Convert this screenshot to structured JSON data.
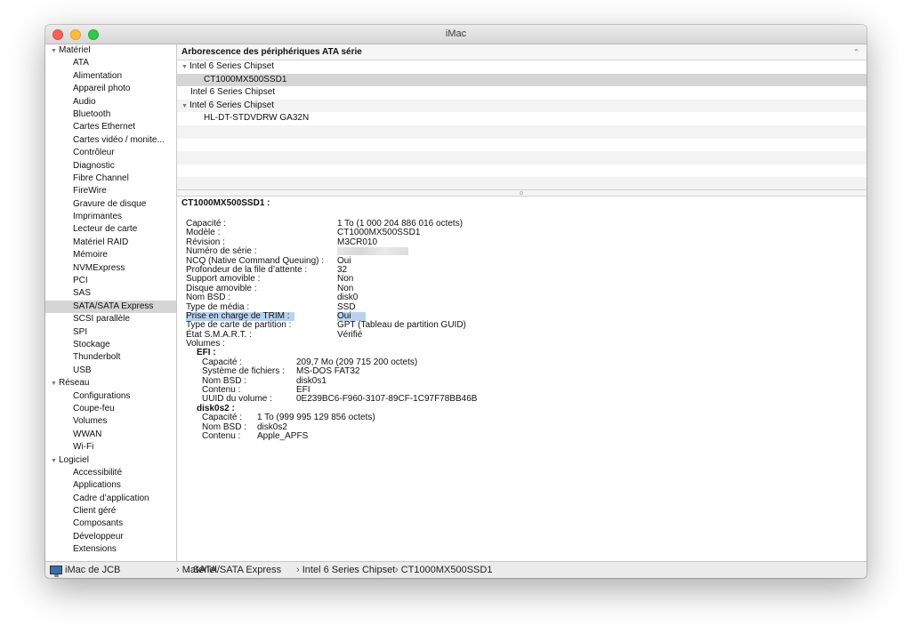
{
  "window": {
    "title": "iMac"
  },
  "sidebar": {
    "items": [
      {
        "label": "Matériel",
        "group": true
      },
      {
        "label": "ATA"
      },
      {
        "label": "Alimentation"
      },
      {
        "label": "Appareil photo"
      },
      {
        "label": "Audio"
      },
      {
        "label": "Bluetooth"
      },
      {
        "label": "Cartes Ethernet"
      },
      {
        "label": "Cartes vidéo / monite..."
      },
      {
        "label": "Contrôleur"
      },
      {
        "label": "Diagnostic"
      },
      {
        "label": "Fibre Channel"
      },
      {
        "label": "FireWire"
      },
      {
        "label": "Gravure de disque"
      },
      {
        "label": "Imprimantes"
      },
      {
        "label": "Lecteur de carte"
      },
      {
        "label": "Matériel RAID"
      },
      {
        "label": "Mémoire"
      },
      {
        "label": "NVMExpress"
      },
      {
        "label": "PCI"
      },
      {
        "label": "SAS"
      },
      {
        "label": "SATA/SATA Express",
        "selected": true
      },
      {
        "label": "SCSI parallèle"
      },
      {
        "label": "SPI"
      },
      {
        "label": "Stockage"
      },
      {
        "label": "Thunderbolt"
      },
      {
        "label": "USB"
      },
      {
        "label": "Réseau",
        "group": true
      },
      {
        "label": "Configurations"
      },
      {
        "label": "Coupe-feu"
      },
      {
        "label": "Volumes"
      },
      {
        "label": "WWAN"
      },
      {
        "label": "Wi-Fi"
      },
      {
        "label": "Logiciel",
        "group": true
      },
      {
        "label": "Accessibilité"
      },
      {
        "label": "Applications"
      },
      {
        "label": "Cadre d’application"
      },
      {
        "label": "Client géré"
      },
      {
        "label": "Composants"
      },
      {
        "label": "Développeur"
      },
      {
        "label": "Extensions"
      }
    ]
  },
  "tree": {
    "header": "Arborescence des périphériques ATA série",
    "rows": [
      {
        "label": "Intel 6 Series Chipset",
        "level": 0,
        "expanded": true
      },
      {
        "label": "CT1000MX500SSD1",
        "level": 1,
        "selected": true
      },
      {
        "label": "Intel 6 Series Chipset",
        "level": 0
      },
      {
        "label": "Intel 6 Series Chipset",
        "level": 0,
        "expanded": true
      },
      {
        "label": "HL-DT-STDVDRW  GA32N",
        "level": 1
      }
    ]
  },
  "detail": {
    "title": "CT1000MX500SSD1 :",
    "properties": [
      {
        "key": "Capacité :",
        "value": "1 To (1 000 204 886 016 octets)"
      },
      {
        "key": "Modèle :",
        "value": "CT1000MX500SSD1"
      },
      {
        "key": "Révision :",
        "value": "M3CR010"
      },
      {
        "key": "Numéro de série :",
        "value": "",
        "redacted": true
      },
      {
        "key": "NCQ (Native Command Queuing) :",
        "value": "Oui"
      },
      {
        "key": "Profondeur de la file d’attente :",
        "value": "32"
      },
      {
        "key": "Support amovible :",
        "value": "Non"
      },
      {
        "key": "Disque amovible :",
        "value": "Non"
      },
      {
        "key": "Nom BSD :",
        "value": "disk0"
      },
      {
        "key": "Type de média :",
        "value": "SSD"
      },
      {
        "key": "Prise en charge de TRIM :",
        "value": "Oui",
        "highlight": true
      },
      {
        "key": "Type de carte de partition :",
        "value": "GPT (Tableau de partition GUID)"
      },
      {
        "key": "État S.M.A.R.T. :",
        "value": "Vérifié"
      },
      {
        "key": "Volumes :",
        "value": ""
      }
    ],
    "volumes": [
      {
        "name": "EFI :",
        "props": [
          {
            "key": "Capacité :",
            "value": "209,7 Mo (209 715 200 octets)"
          },
          {
            "key": "Système de fichiers :",
            "value": "MS-DOS FAT32"
          },
          {
            "key": "Nom BSD :",
            "value": "disk0s1"
          },
          {
            "key": "Contenu :",
            "value": "EFI"
          },
          {
            "key": "UUID du volume :",
            "value": "0E239BC6-F960-3107-89CF-1C97F78BB46B"
          }
        ]
      },
      {
        "name": "disk0s2 :",
        "props": [
          {
            "key": "Capacité :",
            "value": "1 To (999 995 129 856 octets)"
          },
          {
            "key": "Nom BSD :",
            "value": "disk0s2"
          },
          {
            "key": "Contenu :",
            "value": "Apple_APFS"
          }
        ]
      }
    ]
  },
  "pathbar": {
    "icon": "imac-icon",
    "items": [
      "iMac de JCB",
      "Matériel",
      "SATA/SATA Express",
      "Intel 6 Series Chipset",
      "CT1000MX500SSD1"
    ]
  }
}
